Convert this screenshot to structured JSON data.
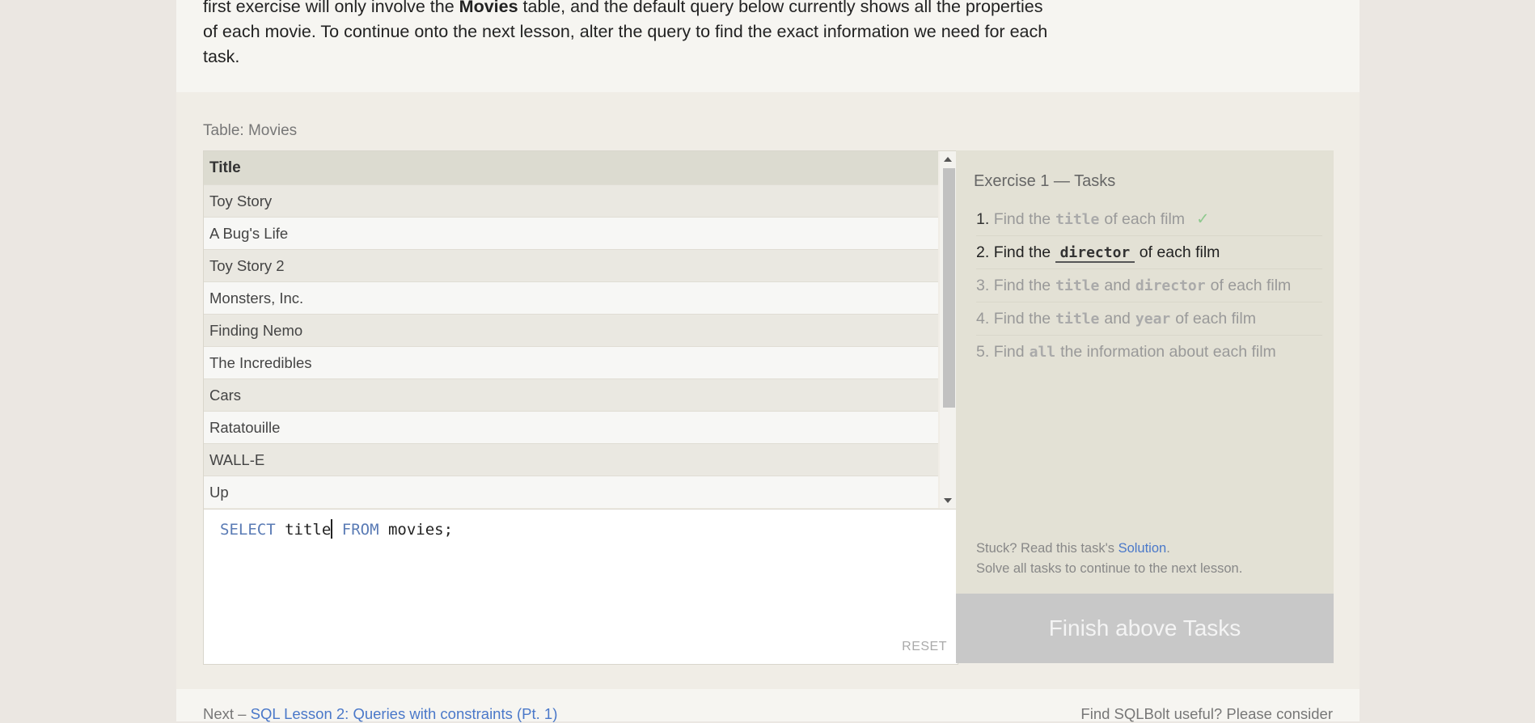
{
  "intro": {
    "line1_pre": "first exercise will only involve the ",
    "line1_bold": "Movies",
    "line1_post": " table, and the default query below currently shows all the properties of each movie. To continue onto the next lesson, alter the query to find the exact information we need for each task."
  },
  "table": {
    "label": "Table: Movies",
    "header": "Title",
    "rows": [
      "Toy Story",
      "A Bug's Life",
      "Toy Story 2",
      "Monsters, Inc.",
      "Finding Nemo",
      "The Incredibles",
      "Cars",
      "Ratatouille",
      "WALL-E",
      "Up"
    ]
  },
  "editor": {
    "kw_select": "SELECT",
    "col": "title",
    "kw_from": "FROM",
    "rest": "movies;",
    "reset": "RESET"
  },
  "tasks": {
    "title": "Exercise 1 — Tasks",
    "items": [
      {
        "num": "1.",
        "pre": "Find the",
        "code1": "title",
        "mid": "",
        "code2": "",
        "post": "of each film",
        "check": "✓"
      },
      {
        "num": "2.",
        "pre": "Find the",
        "code1": "director",
        "mid": "",
        "code2": "",
        "post": "of each film"
      },
      {
        "num": "3.",
        "pre": "Find the",
        "code1": "title",
        "mid": "and",
        "code2": "director",
        "post": "of each film"
      },
      {
        "num": "4.",
        "pre": "Find the",
        "code1": "title",
        "mid": "and",
        "code2": "year",
        "post": "of each film"
      },
      {
        "num": "5.",
        "pre": "Find",
        "code1": "all",
        "mid": "",
        "code2": "",
        "post": "the information about each film"
      }
    ],
    "stuck_pre": "Stuck? Read this task's ",
    "solution_link": "Solution",
    "stuck_post": ".",
    "solve_all": "Solve all tasks to continue to the next lesson.",
    "finish_button": "Finish above Tasks"
  },
  "footer": {
    "next_pre": "Next – ",
    "next_link": "SQL Lesson 2: Queries with constraints (Pt. 1)",
    "right": "Find SQLBolt useful? Please consider"
  }
}
